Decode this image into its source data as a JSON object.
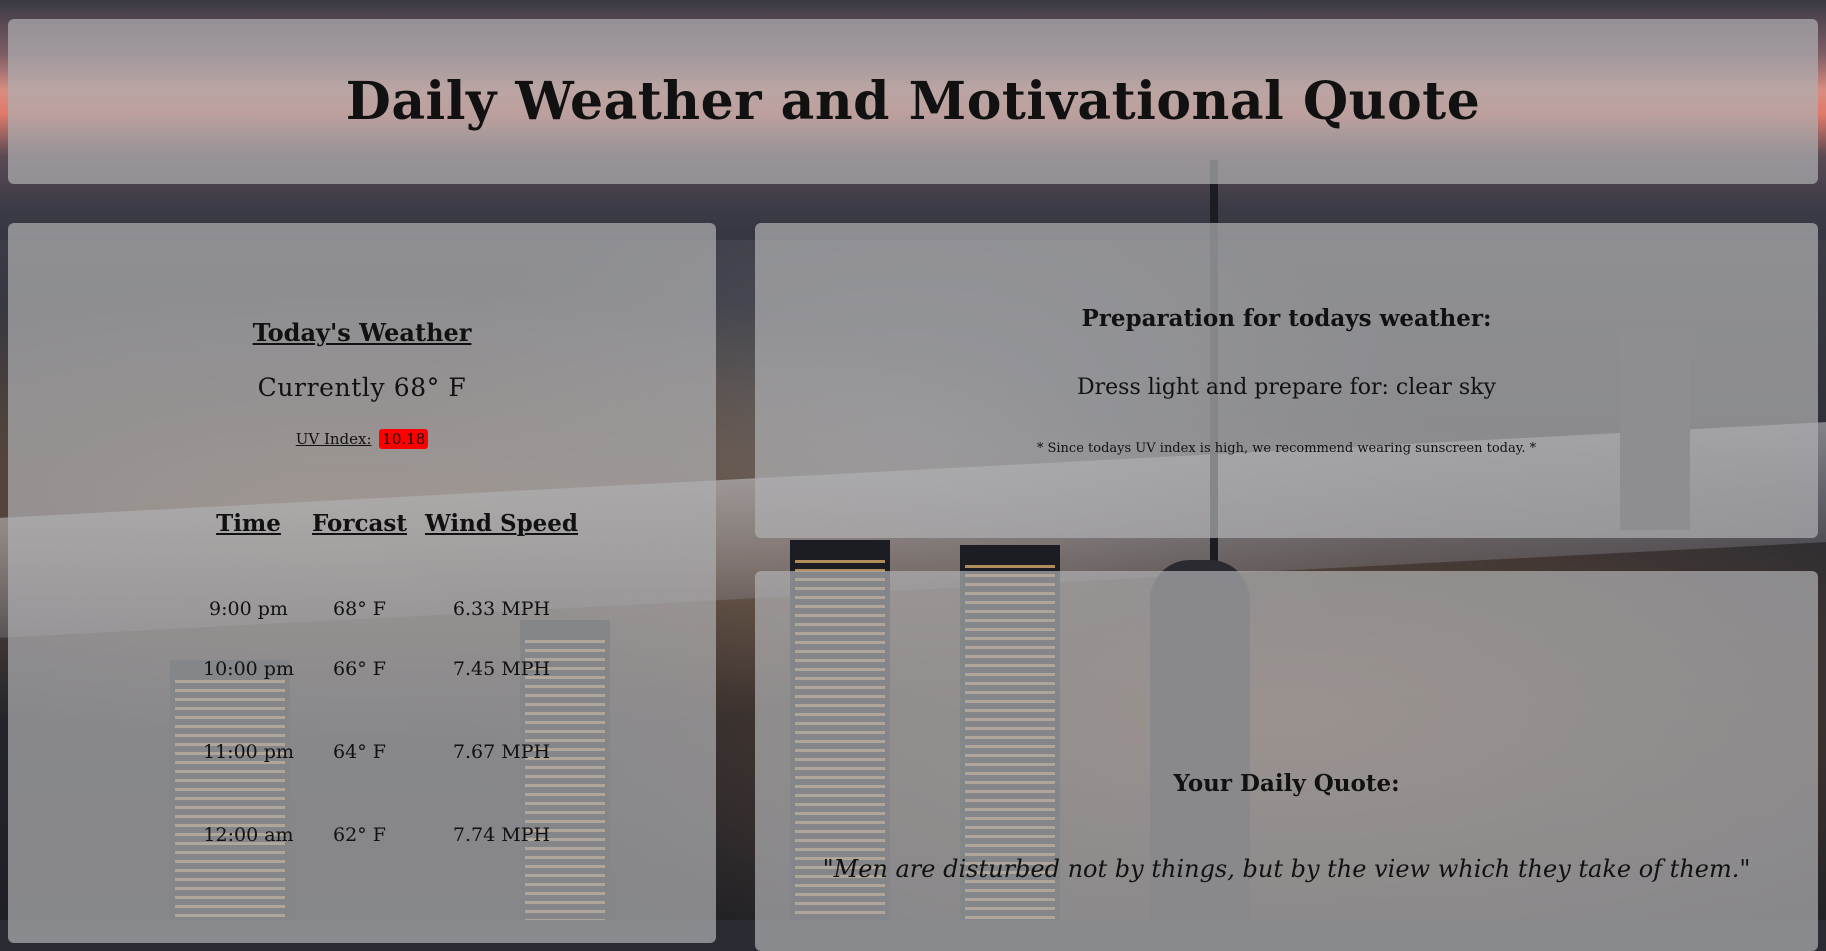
{
  "header": {
    "title": "Daily Weather and Motivational Quote"
  },
  "weather": {
    "heading": "Today's Weather",
    "currently": "Currently 68° F",
    "uv_label": "UV Index:",
    "uv_value": "10.18",
    "uv_color": "#ff0000",
    "columns": [
      "Time",
      "Forcast",
      "Wind Speed"
    ],
    "rows": [
      [
        "9:00 pm",
        "68° F",
        "6.33 MPH"
      ],
      [
        "10:00 pm",
        "66° F",
        "7.45 MPH"
      ],
      [
        "11:00 pm",
        "64° F",
        "7.67 MPH"
      ],
      [
        "12:00 am",
        "62° F",
        "7.74 MPH"
      ]
    ]
  },
  "preparation": {
    "heading": "Preparation for todays weather:",
    "text": "Dress light and prepare for: clear sky",
    "note": "* Since todays UV index is high, we recommend wearing sunscreen today. *"
  },
  "quote": {
    "heading": "Your Daily Quote:",
    "text": "\"Men are disturbed not by things, but by the view which they take of them.\""
  }
}
